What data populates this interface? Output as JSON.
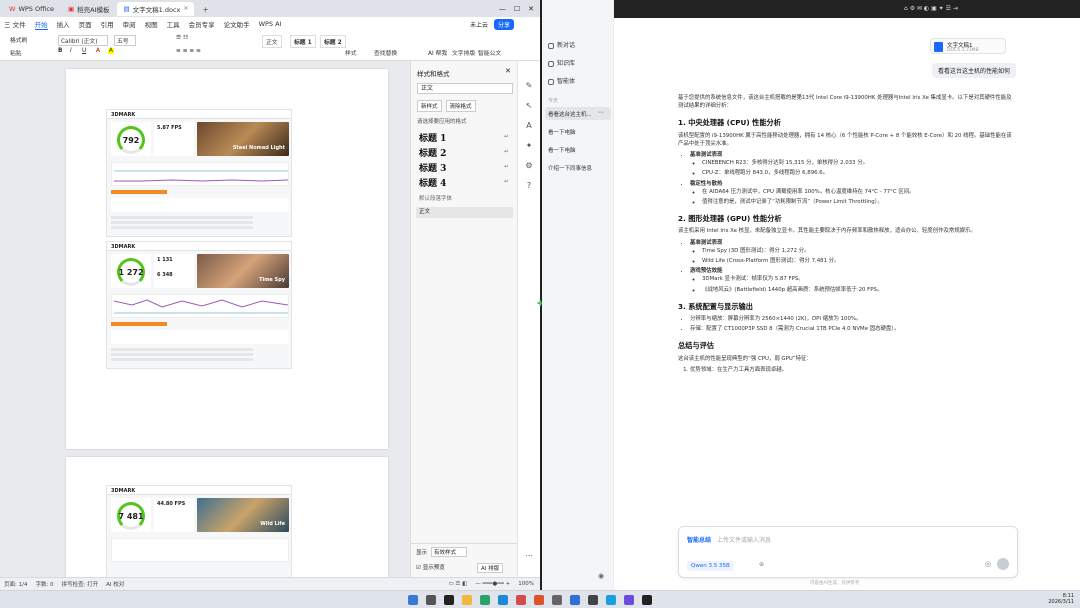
{
  "wps": {
    "tabs": [
      {
        "label": "WPS Office"
      },
      {
        "label": "稻壳AI模板"
      },
      {
        "label": "文字文稿1.docx"
      }
    ],
    "login": "未上云",
    "share": "分享",
    "menu": [
      "三 文件",
      "开始",
      "插入",
      "页面",
      "引用",
      "审阅",
      "视图",
      "工具",
      "会员专享",
      "论文助手",
      "WPS AI"
    ],
    "menu_active_index": 1,
    "ribbon": {
      "format_painter": "格式刷",
      "paste": "粘贴",
      "font": "Calibri (正文)",
      "size": "五号",
      "style_label": "样式",
      "find_replace": "查找替换",
      "ai_label": "AI 帮我",
      "smart_doc": "智能公文",
      "text_ops": "文字排版",
      "normal": "正文",
      "h1": "标题 1",
      "h2": "标题 2"
    },
    "cards": [
      {
        "score": "792",
        "fps": "5.87 FPS",
        "art_title": "Steel Nomad Light"
      },
      {
        "score": "1 272",
        "fps": "1 131",
        "fps2": "6 348",
        "art_title": "Time Spy"
      },
      {
        "score": "7 481",
        "fps": "44.80 FPS",
        "art_title": "Wild Life"
      }
    ],
    "brand": "3DMARK",
    "pane": {
      "title": "样式和格式",
      "current": "正文",
      "btn_new": "新样式",
      "btn_clear": "清除格式",
      "apply_label": "请选择要应用的格式",
      "styles": [
        "标题 1",
        "标题 2",
        "标题 3",
        "标题 4"
      ],
      "default_font": "默认段落字体",
      "body_style": "正文",
      "show_label": "显示",
      "show_value": "有效样式",
      "preview_label": "显示预览",
      "ai_layout": "AI 排版"
    },
    "status": {
      "page": "页面: 1/4",
      "words": "字数: 0",
      "spell": "拼写检查: 打开",
      "ai_proof": "AI 校对",
      "zoom": "100%"
    }
  },
  "ai": {
    "sidebar": {
      "new_chat": "新对话",
      "kb": "知识库",
      "agent": "智能体",
      "today": "今天",
      "history": [
        "看看这台这主机...",
        "看一下电脑",
        "看一下电脑",
        "介绍一下同事信息"
      ]
    },
    "file_chip": {
      "name": "文字文稿1",
      "meta": "DOCX 1.73MB"
    },
    "question": "看看这台这主机的性能如何",
    "answer": {
      "intro": "基于您提供的系统信息文件，该这台主机搭载的是第13代 Intel Core i9-13900HK 处理器与Intel Iris Xe 集成显卡。以下是对其硬件性能及测试结果的详细分析：",
      "s1_title": "1. 中央处理器 (CPU) 性能分析",
      "s1_p": "该机型配置的 i9-13900HK 属于高性能移动处理器，拥有 14 核心（6 个性能核 P-Core + 8 个能效核 E-Core）和 20 线程。基础性能在该产品中处于顶尖水准。",
      "s1_b1": "基准测试表现",
      "s1_b1a": "CINEBENCH R23：多核得分达到 15,315 分，单核得分 2,033 分。",
      "s1_b1b": "CPU-Z：单线程跑分 843.0，多线程跑分 6,896.6。",
      "s1_b2": "稳定性与散热",
      "s1_b2a": "在 AIDA64 压力测试中，CPU 满载使用率 100%，核心温度维持在 74°C - 77°C 区间。",
      "s1_b2b": "值得注意的是，测试中记录了“功耗限制节流”（Power Limit Throttling）。",
      "s2_title": "2. 图形处理器 (GPU) 性能分析",
      "s2_p": "该主机采用 Intel Iris Xe 核显，未配备独立显卡。其性能主要取决于内存频率和散热释放，适合办公、轻度创作及常规娱乐。",
      "s2_b1": "基准测试表现",
      "s2_b1a": "Time Spy (3D 图形测试)：得分 1,272 分。",
      "s2_b1b": "Wild Life (Cross-Platform 图形测试)：得分 7,481 分。",
      "s2_b2": "游戏预估效能",
      "s2_b2a": "3DMark 显卡测试：帧率仅为 5.87 FPS。",
      "s2_b2b": "《战地风云》(Battlefield) 1440p 超高画质：系统预估帧率低于 20 FPS。",
      "s3_title": "3. 系统配置与显示输出",
      "s3_b1": "分辨率与缩放：屏幕分辨率为 2560×1440 (2K)，DPI 缩放为 100%。",
      "s3_b2": "存储：配置了 CT1000P3P SSD 8（需测为 Crucial 1TB PCIe 4.0 NVMe 固态硬盘）。",
      "s4_title": "总结与评估",
      "s4_p": "这台该主机的性能呈现典型的“强 CPU，弱 GPU”特征：",
      "s4_o1": "优势领域：在生产力工具方面表现卓越。"
    },
    "input": {
      "smart": "智能总结",
      "placeholder": "上传文件或输入消息",
      "model": "Qwen 3.5 35B"
    },
    "footer": "内容由AI生成，仅供参考",
    "clock_time": "8:11",
    "clock_date": "2026/3/11"
  }
}
